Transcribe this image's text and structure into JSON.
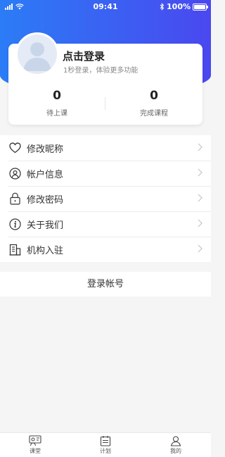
{
  "status_bar": {
    "time": "09:41",
    "battery_text": "100%",
    "icons": [
      "signal-icon",
      "wifi-icon",
      "bluetooth-icon",
      "battery-icon"
    ]
  },
  "profile": {
    "login_title": "点击登录",
    "login_subtitle": "1秒登录，体验更多功能",
    "stats": [
      {
        "value": "0",
        "label": "待上课"
      },
      {
        "value": "0",
        "label": "完成课程"
      }
    ]
  },
  "menu": {
    "items": [
      {
        "label": "修改昵称",
        "icon": "heart-icon"
      },
      {
        "label": "帐户信息",
        "icon": "user-circle-icon"
      },
      {
        "label": "修改密码",
        "icon": "lock-icon"
      },
      {
        "label": "关于我们",
        "icon": "info-icon"
      },
      {
        "label": "机构入驻",
        "icon": "building-icon"
      }
    ]
  },
  "logout_label": "登录帐号",
  "tabbar": {
    "tabs": [
      {
        "label": "课堂",
        "icon": "classroom-icon"
      },
      {
        "label": "计划",
        "icon": "calendar-icon"
      },
      {
        "label": "我的",
        "icon": "profile-icon"
      }
    ]
  },
  "colors": {
    "header_gradient_start": "#2c7cf6",
    "header_gradient_end": "#4a48ef",
    "background": "#f5f5f5",
    "card": "#ffffff"
  }
}
